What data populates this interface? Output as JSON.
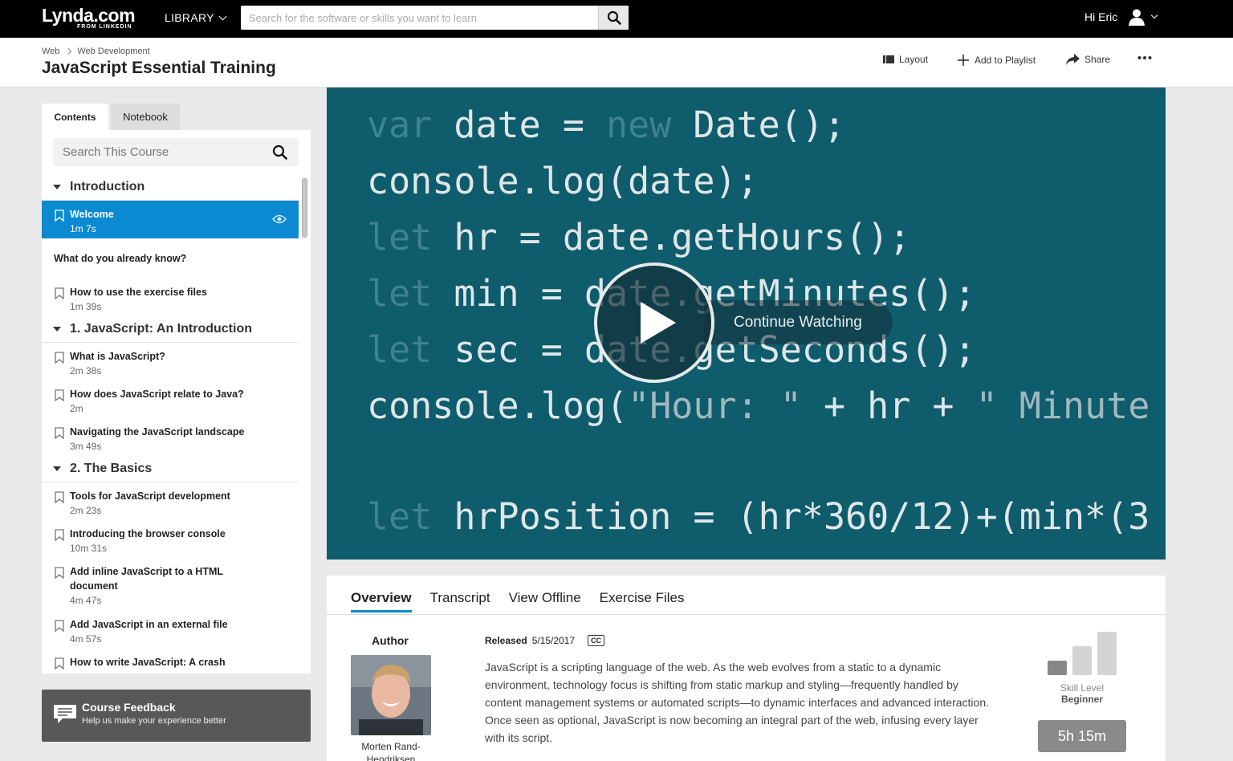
{
  "topbar": {
    "logo": "Lynda.com",
    "logo_sub": "FROM LINKEDIN",
    "library_label": "LIBRARY",
    "search_placeholder": "Search for the software or skills you want to learn",
    "greeting": "Hi Eric"
  },
  "course": {
    "breadcrumb": [
      "Web",
      "Web Development"
    ],
    "title": "JavaScript Essential Training",
    "actions": {
      "layout": "Layout",
      "playlist": "Add to Playlist",
      "share": "Share"
    }
  },
  "sidebar": {
    "tabs": {
      "contents": "Contents",
      "notebook": "Notebook"
    },
    "search_placeholder": "Search This Course",
    "chapters": [
      {
        "title": "Introduction",
        "items": [
          {
            "type": "video",
            "title": "Welcome",
            "duration": "1m 7s",
            "active": true
          },
          {
            "type": "quiz",
            "title": "What do you already know?"
          },
          {
            "type": "video",
            "title": "How to use the exercise files",
            "duration": "1m 39s"
          }
        ]
      },
      {
        "title": "1. JavaScript: An Introduction",
        "items": [
          {
            "type": "video",
            "title": "What is JavaScript?",
            "duration": "2m 38s"
          },
          {
            "type": "video",
            "title": "How does JavaScript relate to Java?",
            "duration": "2m"
          },
          {
            "type": "video",
            "title": "Navigating the JavaScript landscape",
            "duration": "3m 49s"
          }
        ]
      },
      {
        "title": "2. The Basics",
        "items": [
          {
            "type": "video",
            "title": "Tools for JavaScript development",
            "duration": "2m 23s"
          },
          {
            "type": "video",
            "title": "Introducing the browser console",
            "duration": "10m 31s"
          },
          {
            "type": "video",
            "title": "Add inline JavaScript to a HTML document",
            "duration": "4m 47s",
            "tall": true
          },
          {
            "type": "video",
            "title": "Add JavaScript in an external file",
            "duration": "4m 57s"
          },
          {
            "type": "video",
            "title": "How to write JavaScript: A crash",
            "duration": ""
          }
        ]
      }
    ],
    "feedback": {
      "title": "Course Feedback",
      "subtitle": "Help us make your experience better"
    }
  },
  "video": {
    "code_lines": [
      [
        {
          "t": "var ",
          "c": "kw"
        },
        {
          "t": "date = "
        },
        {
          "t": "new ",
          "c": "kw"
        },
        {
          "t": "Date();"
        }
      ],
      [
        {
          "t": "console.log(date);"
        }
      ],
      [
        {
          "t": "let ",
          "c": "kw"
        },
        {
          "t": "hr = date.getHours();"
        }
      ],
      [
        {
          "t": "let ",
          "c": "kw"
        },
        {
          "t": "min = date.getMinutes();"
        }
      ],
      [
        {
          "t": "let ",
          "c": "kw"
        },
        {
          "t": "sec = date.getSeconds();"
        }
      ],
      [
        {
          "t": "console.log("
        },
        {
          "t": "\"Hour: \"",
          "c": "str"
        },
        {
          "t": " + hr + "
        },
        {
          "t": "\" Minute",
          "c": "str"
        }
      ],
      [],
      [
        {
          "t": "let ",
          "c": "kw"
        },
        {
          "t": "hrPosition = (hr*360/12)+(min*(3"
        }
      ]
    ],
    "continue_label": "Continue Watching"
  },
  "details": {
    "tabs": [
      "Overview",
      "Transcript",
      "View Offline",
      "Exercise Files"
    ],
    "active_tab": "Overview",
    "author_label": "Author",
    "author_name": "Morten Rand-Hendriksen",
    "released_label": "Released",
    "released_date": "5/15/2017",
    "cc_label": "CC",
    "description": "JavaScript is a scripting language of the web. As the web evolves from a static to a dynamic environment, technology focus is shifting from static markup and styling—frequently handled by content management systems or automated scripts—to dynamic interfaces and advanced interaction. Once seen as optional, JavaScript is now becoming an integral part of the web, infusing every layer with its script.",
    "skill_label": "Skill Level",
    "skill_level": "Beginner",
    "duration": "5h 15m"
  },
  "colors": {
    "accent": "#0b8ad1",
    "video_bg": "#0e5c6c",
    "topbar": "#000000"
  }
}
